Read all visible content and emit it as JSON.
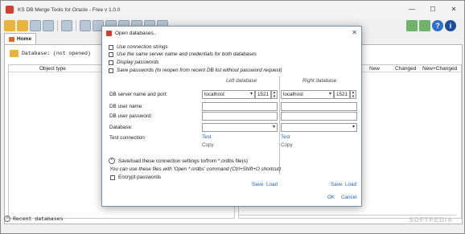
{
  "window": {
    "title": "KS DB Merge Tools for Oracle - Free v 1.0.0",
    "minimize": "—",
    "maximize": "☐",
    "close": "✕"
  },
  "tabs": [
    {
      "label": "Home"
    }
  ],
  "workarea": {
    "db_label": "Database: (not opened)",
    "col_object_type": "Object type",
    "col_new": "New",
    "col_changed": "Changed",
    "col_new_changed": "New+Changed",
    "recent": "Recent databases"
  },
  "watermark": "SOFTPEDIA",
  "dialog": {
    "title": "Open databases..",
    "close": "✕",
    "options": [
      {
        "label": "Use connection strings"
      },
      {
        "label": "Use the same server name and credentials for both databases"
      },
      {
        "label": "Display passwords"
      },
      {
        "label": "Save passwords (to reopen from recent DB list without password request)"
      }
    ],
    "left_title": "Left database",
    "right_title": "Right database",
    "labels": {
      "server": "DB server name and port:",
      "user": "DB user name:",
      "password": "DB user password:",
      "database": "Database:",
      "test": "Test connection:"
    },
    "left": {
      "server": "localhost",
      "port": "1521",
      "test": "Test",
      "copy": "Copy"
    },
    "right": {
      "server": "localhost",
      "port": "1521",
      "test": "Test",
      "copy": "Copy"
    },
    "saveload_label": "Save/load these connection settings to/from *.ordbs file(s)",
    "info": "You can use these files with 'Open *.ordbs' command (Ctrl+Shift+O shortcut)",
    "encrypt": "Encrypt passwords",
    "save": "Save",
    "load": "Load",
    "ok": "OK",
    "cancel": "Cancel"
  }
}
